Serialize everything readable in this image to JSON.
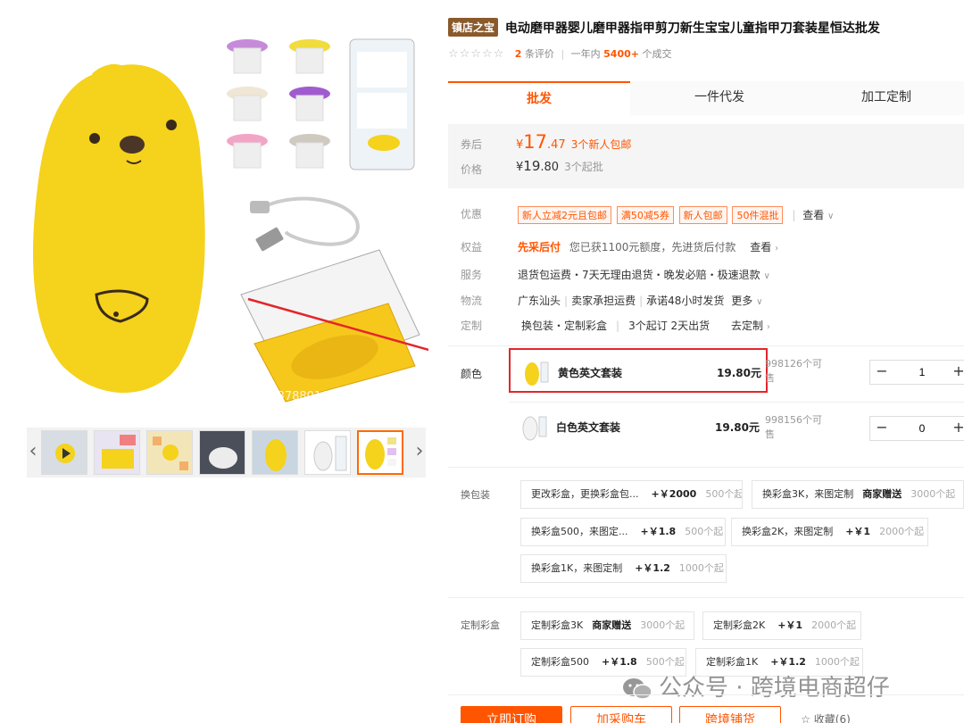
{
  "gallery": {
    "main_image": "yellow-chick-nail-grinder-set",
    "overlay_text": "688788016",
    "thumb_count": 7,
    "active_thumb_index": 6
  },
  "title": {
    "shop_badge": "镇店之宝",
    "text": "电动磨甲器婴儿磨甲器指甲剪刀新生宝宝儿童指甲刀套装星恒达批发"
  },
  "rating": {
    "stars": "☆☆☆☆☆",
    "review_count": "2",
    "review_unit": "条评价",
    "sales_prefix": "一年内",
    "sales_count": "5400+",
    "sales_unit": "个成交"
  },
  "tabs": [
    "批发",
    "一件代发",
    "加工定制"
  ],
  "price": {
    "coupon_label": "券后",
    "coupon_yen": "¥",
    "coupon_int": "17",
    "coupon_dec": ".47",
    "coupon_note": "3个新人包邮",
    "price_label": "价格",
    "price_yen": "¥",
    "price_int": "19",
    "price_dec": ".80",
    "price_note": "3个起批"
  },
  "promo": {
    "label": "优惠",
    "tags": [
      "新人立减2元且包邮",
      "满50减5券",
      "新人包邮",
      "50件混批"
    ],
    "more": "查看"
  },
  "rights": {
    "label": "权益",
    "highlight": "先采后付",
    "text": "您已获1100元额度，先进货后付款",
    "more": "查看"
  },
  "service": {
    "label": "服务",
    "text": "退货包运费・7天无理由退货・晚发必赔・极速退款"
  },
  "logistics": {
    "label": "物流",
    "origin": "广东汕头",
    "freight": "卖家承担运费",
    "promise": "承诺48小时发货",
    "more": "更多"
  },
  "customize": {
    "label": "定制",
    "text": "换包装・定制彩盒",
    "moq": "3个起订 2天出货",
    "more": "去定制"
  },
  "color_label": "颜色",
  "variants": [
    {
      "name": "黄色英文套装",
      "price": "19.80元",
      "stock": "998126个可售",
      "qty": "1",
      "icon": "yellow-set-thumb",
      "selected": true
    },
    {
      "name": "白色英文套装",
      "price": "19.80元",
      "stock": "998156个可售",
      "qty": "0",
      "icon": "white-set-thumb",
      "selected": false
    }
  ],
  "stepper": {
    "minus": "−",
    "plus": "+"
  },
  "repack": {
    "label": "换包装",
    "options": [
      {
        "name": "更改彩盒，更换彩盒包...",
        "price": "+￥2000",
        "gift": "",
        "moq": "500个起"
      },
      {
        "name": "换彩盒3K，来图定制",
        "price": "",
        "gift": "商家赠送",
        "moq": "3000个起"
      },
      {
        "name": "换彩盒500，来图定...",
        "price": "+￥1.8",
        "gift": "",
        "moq": "500个起"
      },
      {
        "name": "换彩盒2K，来图定制",
        "price": "+￥1",
        "gift": "",
        "moq": "2000个起"
      },
      {
        "name": "换彩盒1K，来图定制",
        "price": "+￥1.2",
        "gift": "",
        "moq": "1000个起"
      }
    ]
  },
  "custom_box": {
    "label": "定制彩盒",
    "options": [
      {
        "name": "定制彩盒3K",
        "price": "",
        "gift": "商家赠送",
        "moq": "3000个起"
      },
      {
        "name": "定制彩盒2K",
        "price": "+￥1",
        "gift": "",
        "moq": "2000个起"
      },
      {
        "name": "定制彩盒500",
        "price": "+￥1.8",
        "gift": "",
        "moq": "500个起"
      },
      {
        "name": "定制彩盒1K",
        "price": "+￥1.2",
        "gift": "",
        "moq": "1000个起"
      }
    ]
  },
  "actions": {
    "buy": "立即订购",
    "cart": "加采购车",
    "cross_border": "跨境铺货",
    "favorite": "收藏(6)"
  },
  "watermark": {
    "dot": "·",
    "text": "公众号 · 跨境电商超仔"
  },
  "colors": {
    "accent": "#ff5500",
    "highlight_red": "#e4252a",
    "badge": "#8a5a2b",
    "product_yellow": "#f5d21c"
  }
}
